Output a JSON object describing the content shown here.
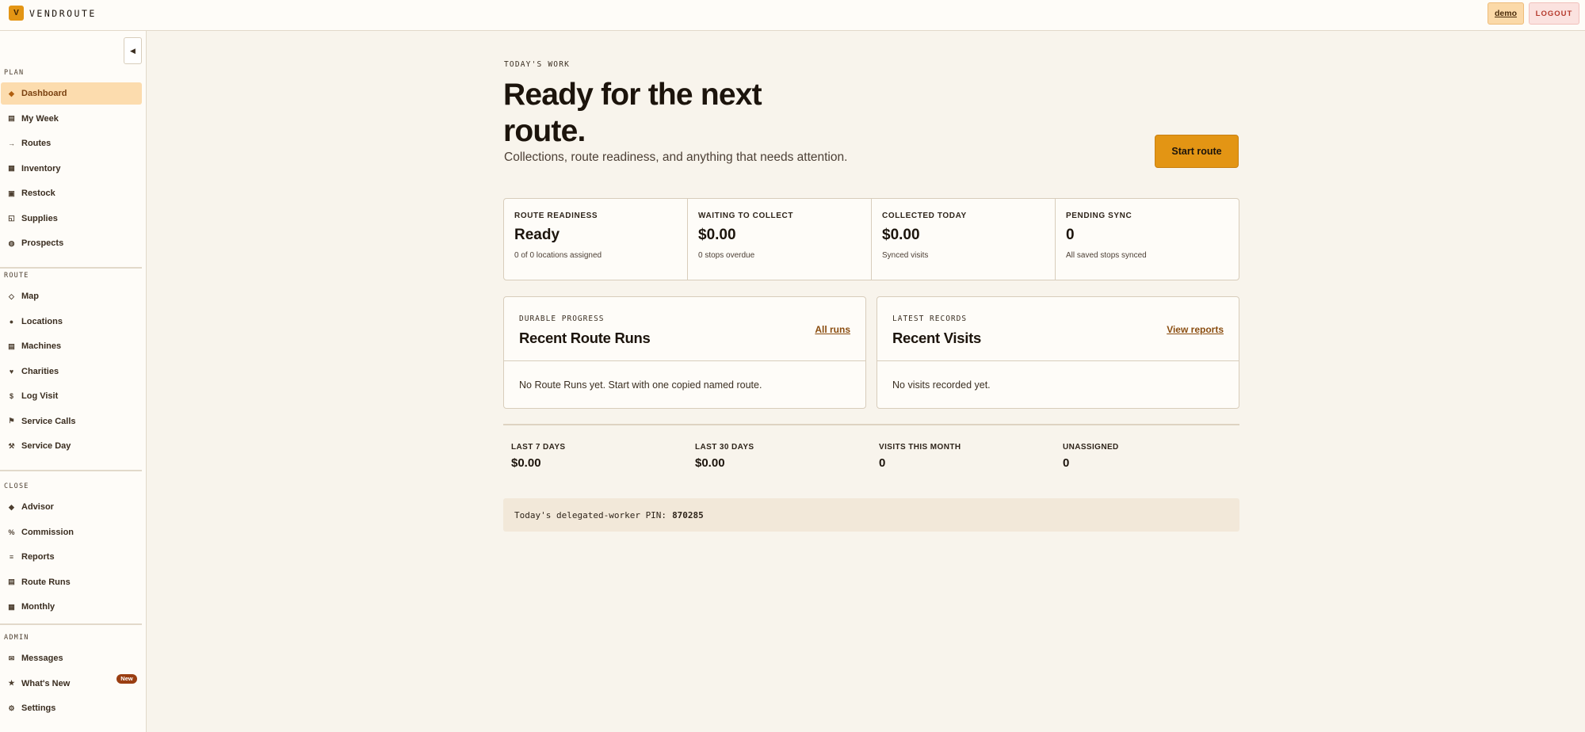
{
  "app": {
    "logo_letter": "V",
    "name": "VENDROUTE"
  },
  "header": {
    "user_label": "demo",
    "logout_label": "LOGOUT"
  },
  "sidebar": {
    "collapse_icon": "◀",
    "sections": [
      {
        "title": "PLAN",
        "items": [
          {
            "label": "Dashboard",
            "icon": "◆",
            "active": true
          },
          {
            "label": "My Week",
            "icon": "▤"
          },
          {
            "label": "Routes",
            "icon": "→"
          },
          {
            "label": "Inventory",
            "icon": "▦"
          },
          {
            "label": "Restock",
            "icon": "▣"
          },
          {
            "label": "Supplies",
            "icon": "◱"
          },
          {
            "label": "Prospects",
            "icon": "◍"
          }
        ]
      },
      {
        "title": "ROUTE",
        "items": [
          {
            "label": "Map",
            "icon": "◇"
          },
          {
            "label": "Locations",
            "icon": "●"
          },
          {
            "label": "Machines",
            "icon": "▤"
          },
          {
            "label": "Charities",
            "icon": "♥"
          },
          {
            "label": "Log Visit",
            "icon": "$"
          },
          {
            "label": "Service Calls",
            "icon": "⚑"
          },
          {
            "label": "Service Day",
            "icon": "⚒"
          }
        ]
      },
      {
        "title": "CLOSE",
        "items": [
          {
            "label": "Advisor",
            "icon": "◆"
          },
          {
            "label": "Commission",
            "icon": "%"
          },
          {
            "label": "Reports",
            "icon": "≡"
          },
          {
            "label": "Route Runs",
            "icon": "▤"
          },
          {
            "label": "Monthly",
            "icon": "▦"
          }
        ]
      },
      {
        "title": "ADMIN",
        "items": [
          {
            "label": "Messages",
            "icon": "✉"
          },
          {
            "label": "What's New",
            "icon": "★",
            "badge": "New"
          },
          {
            "label": "Settings",
            "icon": "⚙"
          }
        ]
      }
    ]
  },
  "main": {
    "eyebrow": "TODAY'S WORK",
    "headline": "Ready for the next route.",
    "subhead": "Collections, route readiness, and anything that needs attention.",
    "start_button": "Start route",
    "stats": [
      {
        "label": "ROUTE READINESS",
        "value": "Ready",
        "sub": "0 of 0 locations assigned"
      },
      {
        "label": "WAITING TO COLLECT",
        "value": "$0.00",
        "sub": "0 stops overdue"
      },
      {
        "label": "COLLECTED TODAY",
        "value": "$0.00",
        "sub": "Synced visits"
      },
      {
        "label": "PENDING SYNC",
        "value": "0",
        "sub": "All saved stops synced"
      }
    ],
    "panels": [
      {
        "eyebrow": "DURABLE PROGRESS",
        "title": "Recent Route Runs",
        "link": "All runs",
        "body": "No Route Runs yet. Start with one copied named route."
      },
      {
        "eyebrow": "LATEST RECORDS",
        "title": "Recent Visits",
        "link": "View reports",
        "body": "No visits recorded yet."
      }
    ],
    "summary": [
      {
        "label": "LAST 7 DAYS",
        "value": "$0.00"
      },
      {
        "label": "LAST 30 DAYS",
        "value": "$0.00"
      },
      {
        "label": "VISITS THIS MONTH",
        "value": "0"
      },
      {
        "label": "UNASSIGNED",
        "value": "0"
      }
    ],
    "pin": {
      "label": "Today's delegated-worker PIN:",
      "value": "870285"
    }
  }
}
